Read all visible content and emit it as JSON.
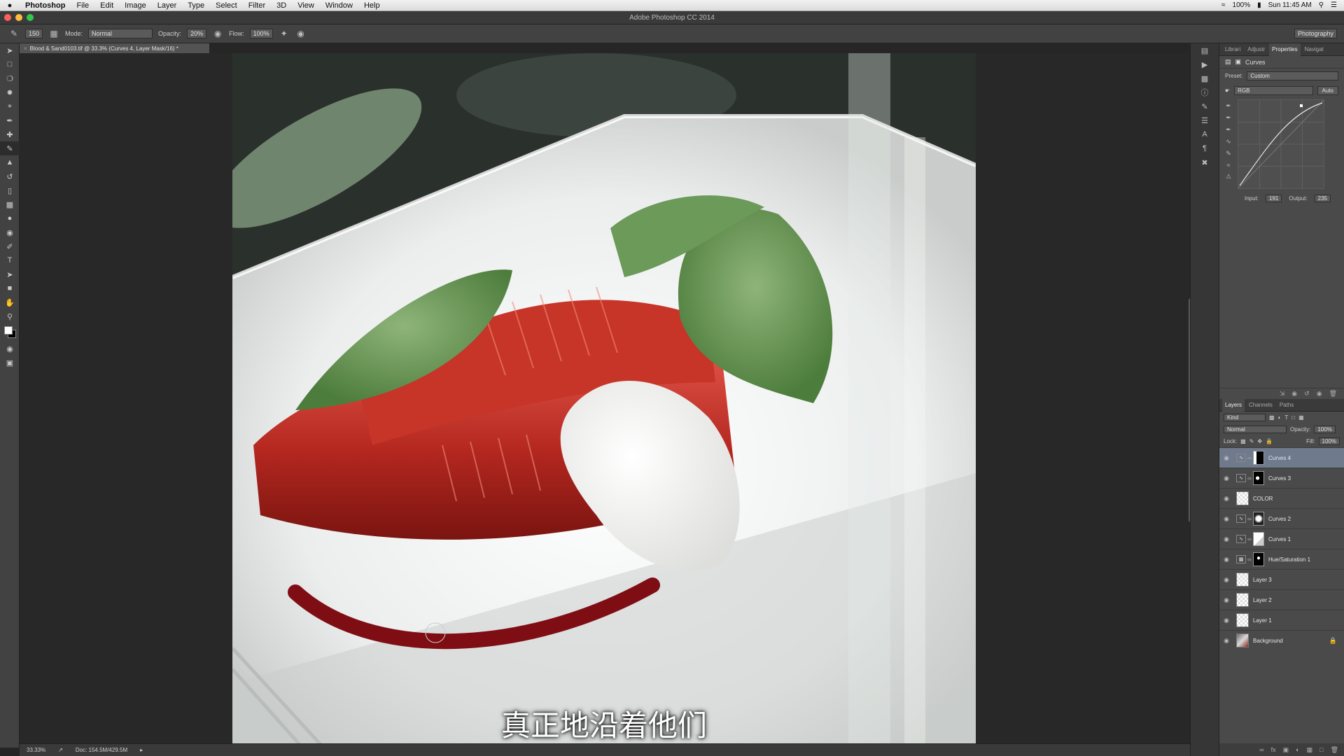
{
  "menubar": {
    "app": "Photoshop",
    "items": [
      "File",
      "Edit",
      "Image",
      "Layer",
      "Type",
      "Select",
      "Filter",
      "3D",
      "View",
      "Window",
      "Help"
    ],
    "battery": "100%",
    "clock": "Sun 11:45 AM"
  },
  "window": {
    "title": "Adobe Photoshop CC 2014"
  },
  "options": {
    "brush_size": "150",
    "mode_label": "Mode:",
    "mode_value": "Normal",
    "opacity_label": "Opacity:",
    "opacity_value": "20%",
    "flow_label": "Flow:",
    "flow_value": "100%",
    "workspace": "Photography"
  },
  "document": {
    "tab_title": "Blood & Sand0103.tif @ 33.3% (Curves 4, Layer Mask/16) *"
  },
  "subtitle": "真正地沿着他们",
  "status": {
    "zoom": "33.33%",
    "doc": "Doc: 154.5M/429.5M"
  },
  "panels": {
    "top_tabs": [
      "Librari",
      "Adjustr",
      "Properties",
      "Navigat"
    ],
    "active_tab": "Properties",
    "properties": {
      "title": "Curves",
      "preset_label": "Preset:",
      "preset_value": "Custom",
      "channel": "RGB",
      "auto_label": "Auto",
      "input_label": "Input:",
      "input_value": "191",
      "output_label": "Output:",
      "output_value": "235"
    },
    "layer_tabs": [
      "Layers",
      "Channels",
      "Paths"
    ],
    "kind_label": "Kind",
    "blend_mode": "Normal",
    "opacity_label": "Opacity:",
    "opacity_value": "100%",
    "lock_label": "Lock:",
    "fill_label": "Fill:",
    "fill_value": "100%",
    "layers": [
      {
        "name": "Curves 4"
      },
      {
        "name": "Curves 3"
      },
      {
        "name": "COLOR"
      },
      {
        "name": "Curves 2"
      },
      {
        "name": "Curves 1"
      },
      {
        "name": "Hue/Saturation 1"
      },
      {
        "name": "Layer 3"
      },
      {
        "name": "Layer 2"
      },
      {
        "name": "Layer 1"
      },
      {
        "name": "Background"
      }
    ]
  }
}
